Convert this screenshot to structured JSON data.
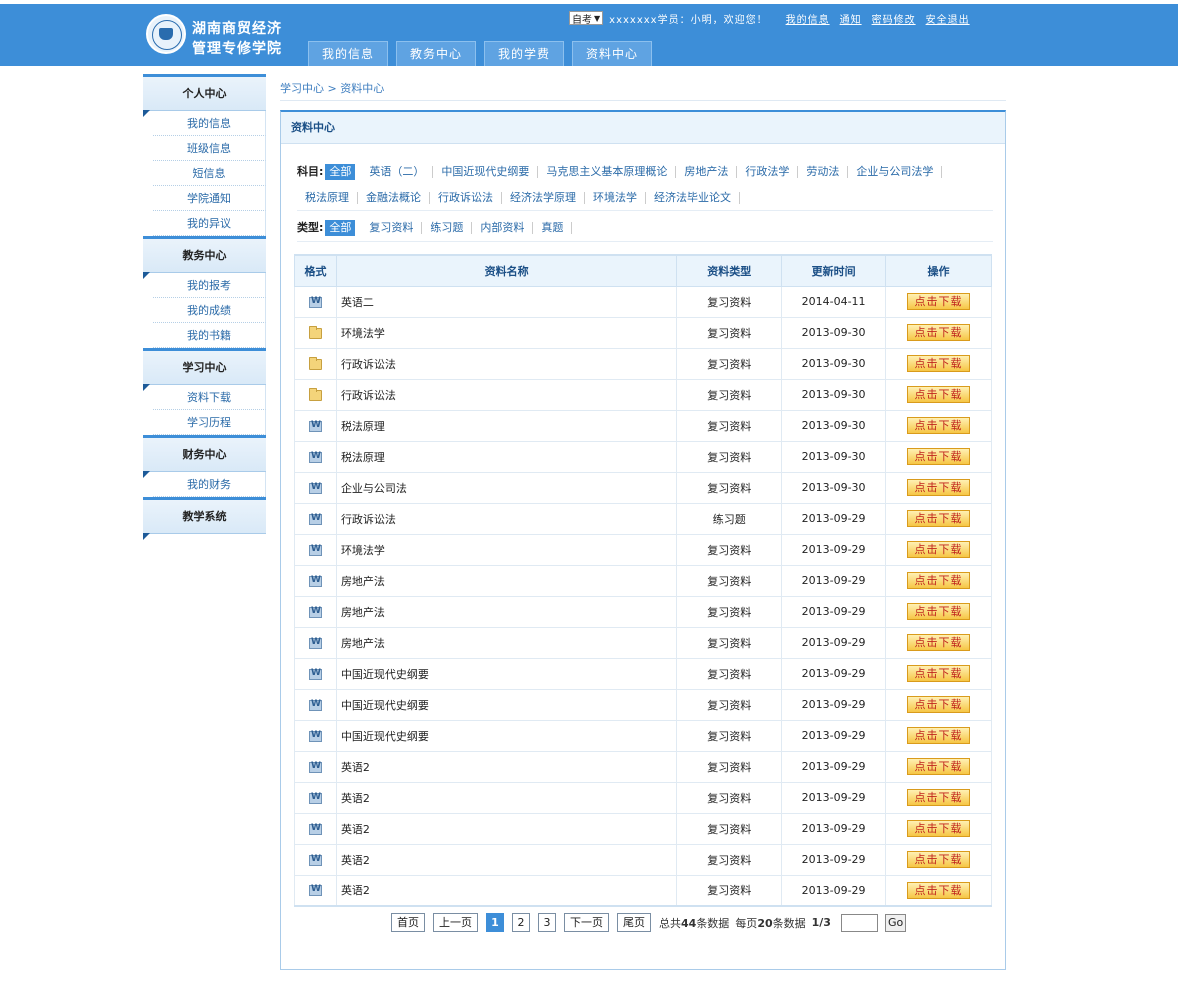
{
  "header": {
    "logo_line1": "湖南商贸经济",
    "logo_line2": "管理专修学院",
    "exam_select": "自考",
    "greeting": "xxxxxxx学员：小明，欢迎您！",
    "links": [
      "我的信息",
      "通知",
      "密码修改",
      "安全退出"
    ],
    "nav_tabs": [
      "我的信息",
      "教务中心",
      "我的学费",
      "资料中心"
    ]
  },
  "sidebar": {
    "groups": [
      {
        "title": "个人中心",
        "items": [
          "我的信息",
          "班级信息",
          "短信息",
          "学院通知",
          "我的异议"
        ]
      },
      {
        "title": "教务中心",
        "items": [
          "我的报考",
          "我的成绩",
          "我的书籍"
        ]
      },
      {
        "title": "学习中心",
        "items": [
          "资料下载",
          "学习历程"
        ]
      },
      {
        "title": "财务中心",
        "items": [
          "我的财务"
        ]
      },
      {
        "title": "教学系统",
        "items": []
      }
    ]
  },
  "breadcrumb": "学习中心 > 资料中心",
  "panel_title": "资料中心",
  "filters": {
    "subject_label": "科目:",
    "subjects": [
      "全部",
      "英语（二）",
      "中国近现代史纲要",
      "马克思主义基本原理概论",
      "房地产法",
      "行政法学",
      "劳动法",
      "企业与公司法学",
      "税法原理",
      "金融法概论",
      "行政诉讼法",
      "经济法学原理",
      "环境法学",
      "经济法毕业论文"
    ],
    "type_label": "类型:",
    "types": [
      "全部",
      "复习资料",
      "练习题",
      "内部资料",
      "真题"
    ]
  },
  "table": {
    "headers": [
      "格式",
      "资料名称",
      "资料类型",
      "更新时间",
      "操作"
    ],
    "download_label": "点击下载",
    "rows": [
      {
        "format": "word",
        "name": "英语二",
        "type": "复习资料",
        "date": "2014-04-11"
      },
      {
        "format": "folder",
        "name": "环境法学",
        "type": "复习资料",
        "date": "2013-09-30"
      },
      {
        "format": "folder",
        "name": "行政诉讼法",
        "type": "复习资料",
        "date": "2013-09-30"
      },
      {
        "format": "folder",
        "name": "行政诉讼法",
        "type": "复习资料",
        "date": "2013-09-30"
      },
      {
        "format": "word",
        "name": "税法原理",
        "type": "复习资料",
        "date": "2013-09-30"
      },
      {
        "format": "word",
        "name": "税法原理",
        "type": "复习资料",
        "date": "2013-09-30"
      },
      {
        "format": "word",
        "name": "企业与公司法",
        "type": "复习资料",
        "date": "2013-09-30"
      },
      {
        "format": "word",
        "name": "行政诉讼法",
        "type": "练习题",
        "date": "2013-09-29"
      },
      {
        "format": "word",
        "name": "环境法学",
        "type": "复习资料",
        "date": "2013-09-29"
      },
      {
        "format": "word",
        "name": "房地产法",
        "type": "复习资料",
        "date": "2013-09-29"
      },
      {
        "format": "word",
        "name": "房地产法",
        "type": "复习资料",
        "date": "2013-09-29"
      },
      {
        "format": "word",
        "name": "房地产法",
        "type": "复习资料",
        "date": "2013-09-29"
      },
      {
        "format": "word",
        "name": "中国近现代史纲要",
        "type": "复习资料",
        "date": "2013-09-29"
      },
      {
        "format": "word",
        "name": "中国近现代史纲要",
        "type": "复习资料",
        "date": "2013-09-29"
      },
      {
        "format": "word",
        "name": "中国近现代史纲要",
        "type": "复习资料",
        "date": "2013-09-29"
      },
      {
        "format": "word",
        "name": "英语2",
        "type": "复习资料",
        "date": "2013-09-29"
      },
      {
        "format": "word",
        "name": "英语2",
        "type": "复习资料",
        "date": "2013-09-29"
      },
      {
        "format": "word",
        "name": "英语2",
        "type": "复习资料",
        "date": "2013-09-29"
      },
      {
        "format": "word",
        "name": "英语2",
        "type": "复习资料",
        "date": "2013-09-29"
      },
      {
        "format": "word",
        "name": "英语2",
        "type": "复习资料",
        "date": "2013-09-29"
      }
    ]
  },
  "pager": {
    "first": "首页",
    "prev": "上一页",
    "pages": [
      "1",
      "2",
      "3"
    ],
    "current": "1",
    "next": "下一页",
    "last": "尾页",
    "total_prefix": "总共",
    "total": "44",
    "total_suffix": "条数据",
    "per_page_prefix": "每页",
    "per_page": "20",
    "per_page_suffix": "条数据",
    "page_of": "1/3",
    "go": "Go"
  }
}
